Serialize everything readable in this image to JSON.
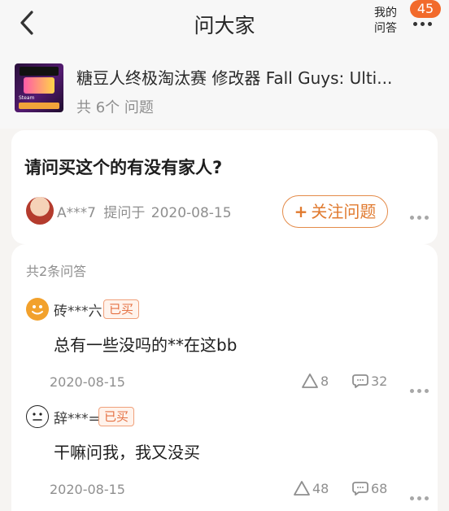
{
  "header": {
    "title": "问大家",
    "my_questions_label": "我的\n问答",
    "badge": "45",
    "back_icon": "back-icon",
    "more_icon": "more-icon"
  },
  "product": {
    "title": "糖豆人终极淘汰赛 修改器 Fall Guys: Ulti...",
    "question_count": "共 6个 问题",
    "thumbnail_steam_text": "Steam"
  },
  "question": {
    "text": "请问买这个的有没有家人?",
    "asker": "A***7",
    "asked_date_prefix": "提问于",
    "asked_date": "2020-08-15",
    "follow_label": "关注问题",
    "follow_plus": "+"
  },
  "answers": {
    "count_label": "共2条问答",
    "items": [
      {
        "user": "砖***六",
        "tag": "已买",
        "text": "总有一些没吗的**在这bb",
        "date": "2020-08-15",
        "likes": "8",
        "comments": "32"
      },
      {
        "user": "辞***=",
        "tag": "已买",
        "text": "干嘛问我，我又没买",
        "date": "2020-08-15",
        "likes": "48",
        "comments": "68"
      }
    ]
  },
  "colors": {
    "accent_orange": "#f26a2b",
    "follow_orange": "#e07a2f",
    "tag_orange": "#e57244",
    "text_gray": "#8f8f8f",
    "page_bg": "#f6f4f2"
  }
}
